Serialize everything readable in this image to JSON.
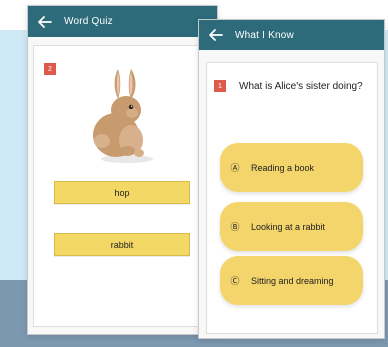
{
  "left_screen": {
    "title": "Word Quiz",
    "badge": "2",
    "options": [
      {
        "label": "hop"
      },
      {
        "label": "rabbit"
      }
    ]
  },
  "right_screen": {
    "title": "What I Know",
    "badge": "1",
    "question": "What is Alice's sister doing?",
    "answers": [
      {
        "marker": "Ⓐ",
        "label": "Reading a book"
      },
      {
        "marker": "Ⓑ",
        "label": "Looking at a rabbit"
      },
      {
        "marker": "Ⓒ",
        "label": "Sitting and dreaming"
      }
    ]
  },
  "icons": {
    "back": "arrow-left-icon",
    "illustration": "rabbit-illustration"
  },
  "colors": {
    "appbar": "#2d6b7a",
    "badge": "#de5a4a",
    "option": "#f4d866",
    "answer": "#f3d56c",
    "background_light": "#cfe9f6",
    "background_steel": "#7c98b1"
  }
}
